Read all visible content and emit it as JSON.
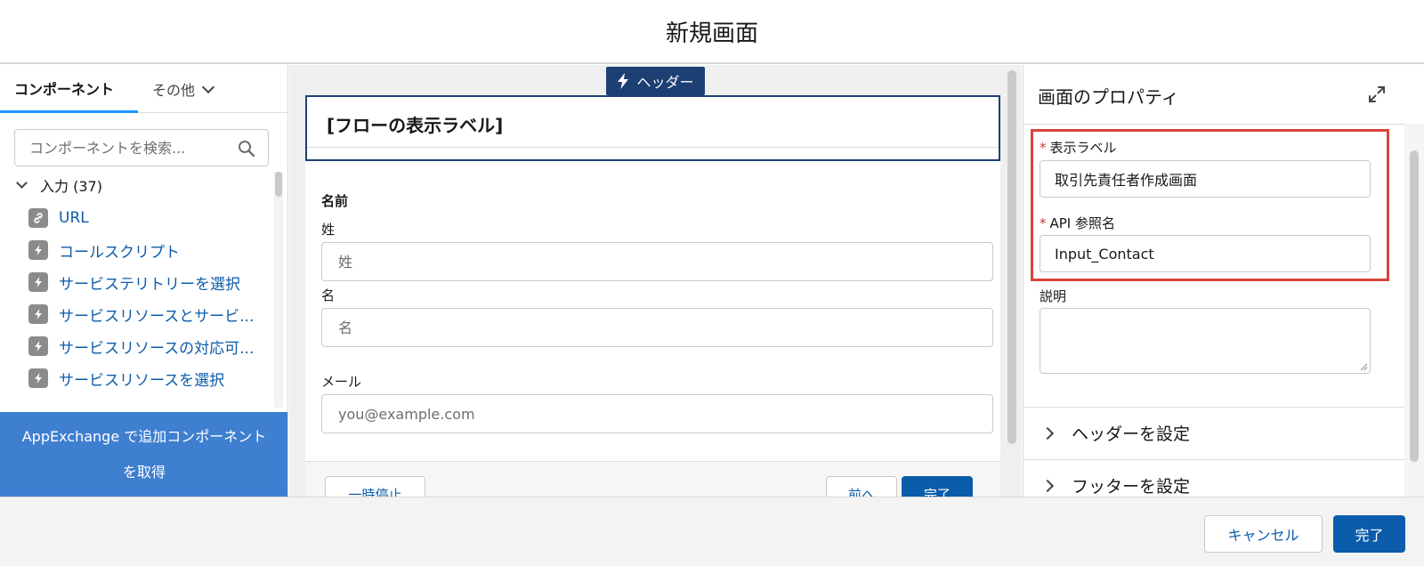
{
  "modal": {
    "title": "新規画面"
  },
  "left_panel": {
    "tabs": [
      {
        "label": "コンポーネント",
        "active": true
      },
      {
        "label": "その他",
        "active": false
      }
    ],
    "search_placeholder": "コンポーネントを検索...",
    "section": {
      "label": "入力 (37)"
    },
    "components": [
      {
        "label": "URL",
        "icon": "link-icon"
      },
      {
        "label": "コールスクリプト",
        "icon": "lightning-icon"
      },
      {
        "label": "サービステリトリーを選択",
        "icon": "lightning-icon"
      },
      {
        "label": "サービスリソースとサービ...",
        "icon": "lightning-icon"
      },
      {
        "label": "サービスリソースの対応可...",
        "icon": "lightning-icon"
      },
      {
        "label": "サービスリソースを選択",
        "icon": "lightning-icon"
      }
    ],
    "appexchange_label": "AppExchange で追加コンポーネントを取得"
  },
  "canvas": {
    "header_badge": "ヘッダー",
    "header_title": "[フローの表示ラベル]",
    "field_group_label": "名前",
    "fields": [
      {
        "label": "姓",
        "placeholder": "姓"
      },
      {
        "label": "名",
        "placeholder": "名"
      },
      {
        "label": "メール",
        "placeholder": "you@example.com"
      }
    ],
    "nav": {
      "pause": "一時停止",
      "previous": "前へ",
      "finish": "完了"
    }
  },
  "properties": {
    "title": "画面のプロパティ",
    "label_field": {
      "label": "表示ラベル",
      "value": "取引先責任者作成画面"
    },
    "api_field": {
      "label": "API 参照名",
      "value": "Input_Contact"
    },
    "description_label": "説明",
    "sections": [
      {
        "label": "ヘッダーを設定"
      },
      {
        "label": "フッターを設定"
      }
    ]
  },
  "footer": {
    "cancel": "キャンセル",
    "done": "完了"
  },
  "colors": {
    "brand": "#0b5cab",
    "highlight": "#d9443a",
    "header_badge": "#1c3f74",
    "appexchange": "#3f7fd0"
  }
}
